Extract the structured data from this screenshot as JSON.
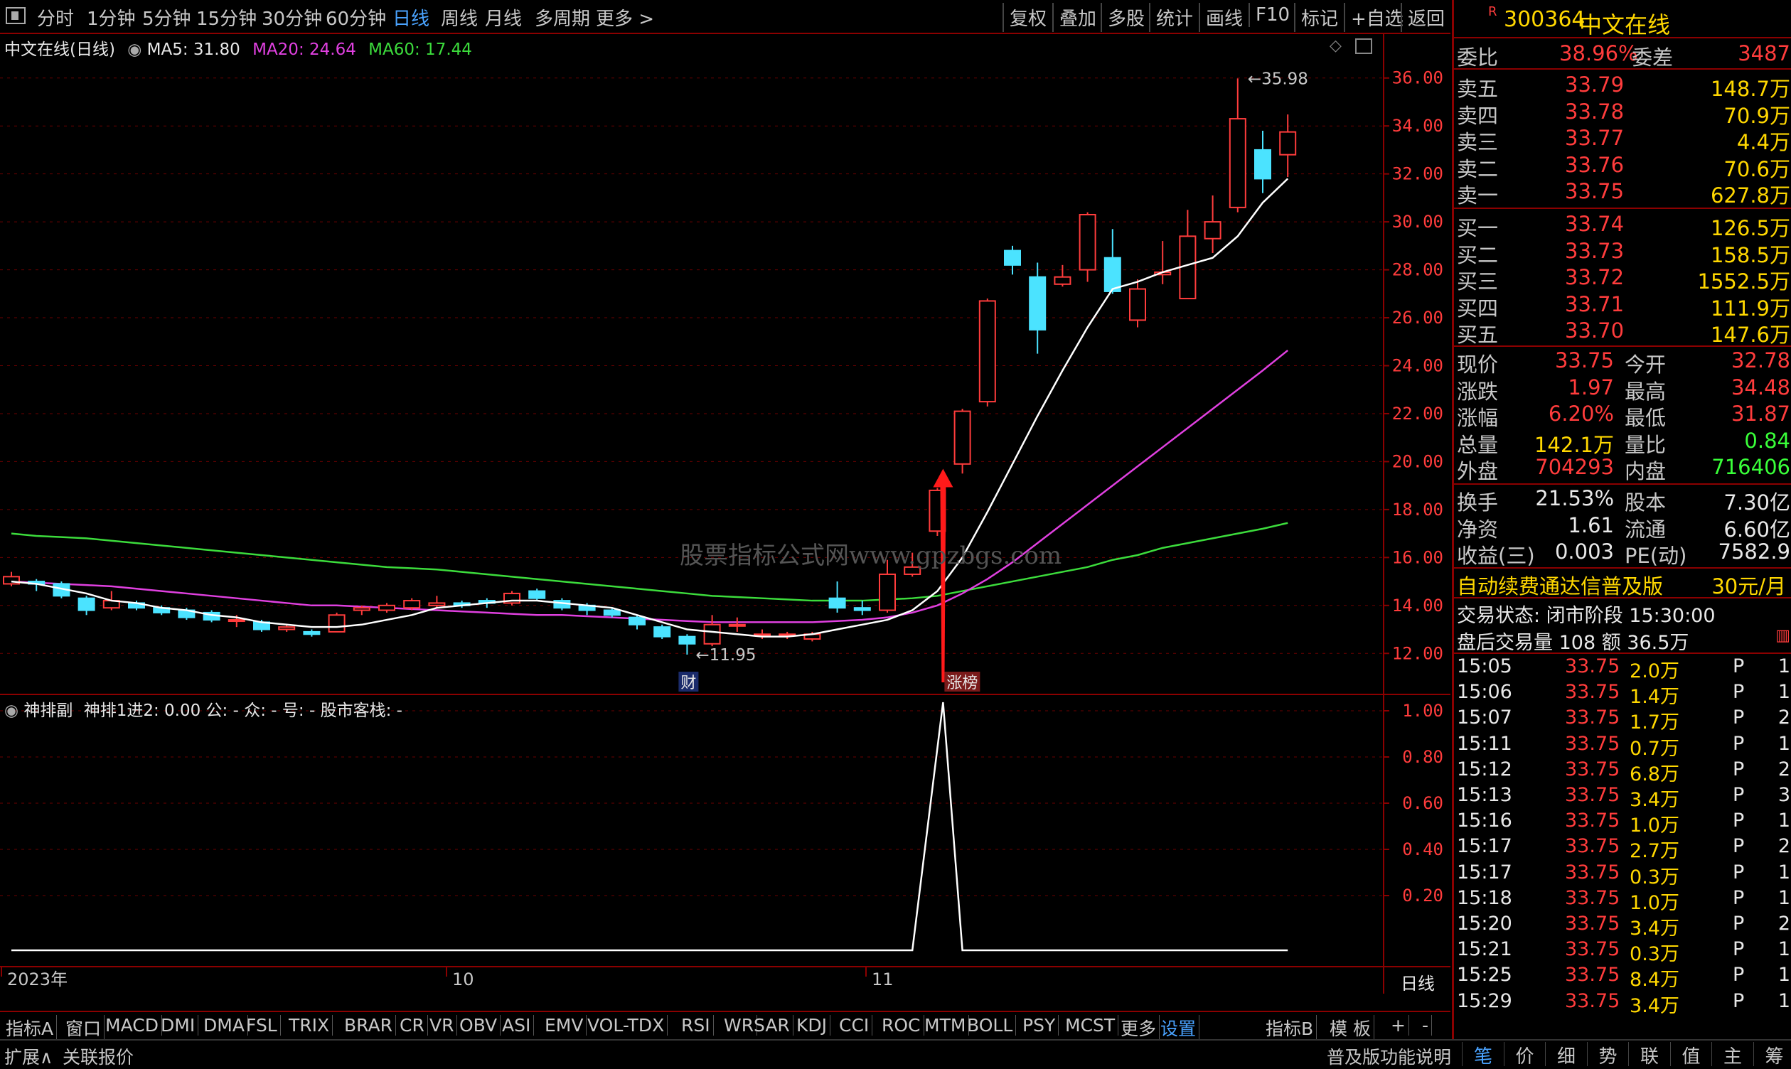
{
  "toolbar": {
    "periods": [
      "分时",
      "1分钟",
      "5分钟",
      "15分钟",
      "30分钟",
      "60分钟",
      "日线",
      "周线",
      "月线",
      "多周期",
      "更多 >"
    ],
    "active_period": "日线",
    "right_buttons": [
      "复权",
      "叠加",
      "多股",
      "统计",
      "画线",
      "F10",
      "标记",
      "+自选",
      "返回"
    ]
  },
  "main_chart": {
    "stock_title": "中文在线(日线)",
    "ma5": "MA5: 31.80",
    "ma20": "MA20: 24.64",
    "ma60": "MA60: 17.44",
    "high_label": "35.98",
    "low_label": "11.95",
    "marker_cai": "财",
    "marker_zhangbang": "涨榜",
    "watermark": "股票指标公式网www.gpzbgs.com",
    "x_labels": [
      "2023年",
      "10",
      "11"
    ],
    "y_ticks": [
      "36.00",
      "34.00",
      "32.00",
      "30.00",
      "28.00",
      "26.00",
      "24.00",
      "22.00",
      "20.00",
      "18.00",
      "16.00",
      "14.00",
      "12.00"
    ]
  },
  "sub_chart": {
    "title": "神排副",
    "params": "神排1进2: 0.00 公: - 众: - 号: - 股市客栈: -",
    "y_ticks": [
      "1.00",
      "0.80",
      "0.60",
      "0.40",
      "0.20"
    ],
    "period_label": "日线"
  },
  "chart_data": {
    "type": "candlestick",
    "ylim": [
      11,
      37
    ],
    "candles": [
      {
        "o": 14.9,
        "c": 15.2,
        "h": 15.4,
        "l": 14.8
      },
      {
        "o": 15.0,
        "c": 14.9,
        "h": 15.1,
        "l": 14.6
      },
      {
        "o": 14.9,
        "c": 14.4,
        "h": 15.0,
        "l": 14.3
      },
      {
        "o": 14.3,
        "c": 13.8,
        "h": 14.4,
        "l": 13.6
      },
      {
        "o": 13.9,
        "c": 14.2,
        "h": 14.6,
        "l": 13.8
      },
      {
        "o": 14.1,
        "c": 13.9,
        "h": 14.2,
        "l": 13.8
      },
      {
        "o": 13.9,
        "c": 13.7,
        "h": 14.0,
        "l": 13.6
      },
      {
        "o": 13.8,
        "c": 13.5,
        "h": 13.9,
        "l": 13.4
      },
      {
        "o": 13.7,
        "c": 13.4,
        "h": 13.8,
        "l": 13.3
      },
      {
        "o": 13.4,
        "c": 13.4,
        "h": 13.6,
        "l": 13.1
      },
      {
        "o": 13.3,
        "c": 13.0,
        "h": 13.4,
        "l": 12.9
      },
      {
        "o": 13.0,
        "c": 13.1,
        "h": 13.2,
        "l": 12.9
      },
      {
        "o": 12.9,
        "c": 12.8,
        "h": 13.0,
        "l": 12.7
      },
      {
        "o": 12.9,
        "c": 13.6,
        "h": 13.7,
        "l": 12.9
      },
      {
        "o": 13.8,
        "c": 13.9,
        "h": 14.0,
        "l": 13.6
      },
      {
        "o": 13.8,
        "c": 14.0,
        "h": 14.1,
        "l": 13.7
      },
      {
        "o": 13.9,
        "c": 14.2,
        "h": 14.3,
        "l": 13.8
      },
      {
        "o": 14.0,
        "c": 14.1,
        "h": 14.4,
        "l": 13.9
      },
      {
        "o": 14.1,
        "c": 14.0,
        "h": 14.2,
        "l": 13.9
      },
      {
        "o": 14.2,
        "c": 14.1,
        "h": 14.3,
        "l": 13.9
      },
      {
        "o": 14.1,
        "c": 14.5,
        "h": 14.6,
        "l": 14.0
      },
      {
        "o": 14.6,
        "c": 14.3,
        "h": 14.7,
        "l": 14.2
      },
      {
        "o": 14.2,
        "c": 13.9,
        "h": 14.3,
        "l": 13.8
      },
      {
        "o": 14.0,
        "c": 13.8,
        "h": 14.1,
        "l": 13.6
      },
      {
        "o": 13.8,
        "c": 13.6,
        "h": 13.9,
        "l": 13.5
      },
      {
        "o": 13.5,
        "c": 13.2,
        "h": 13.6,
        "l": 13.0
      },
      {
        "o": 13.1,
        "c": 12.7,
        "h": 13.2,
        "l": 12.6
      },
      {
        "o": 12.7,
        "c": 12.4,
        "h": 12.8,
        "l": 11.95
      },
      {
        "o": 12.4,
        "c": 13.2,
        "h": 13.6,
        "l": 12.3
      },
      {
        "o": 13.2,
        "c": 13.2,
        "h": 13.5,
        "l": 12.9
      },
      {
        "o": 12.8,
        "c": 12.8,
        "h": 13.0,
        "l": 12.6
      },
      {
        "o": 12.8,
        "c": 12.8,
        "h": 12.9,
        "l": 12.6
      },
      {
        "o": 12.6,
        "c": 12.8,
        "h": 12.9,
        "l": 12.5
      },
      {
        "o": 14.3,
        "c": 13.9,
        "h": 15.0,
        "l": 13.7
      },
      {
        "o": 13.9,
        "c": 13.8,
        "h": 14.2,
        "l": 13.6
      },
      {
        "o": 13.8,
        "c": 15.3,
        "h": 15.9,
        "l": 13.7
      },
      {
        "o": 15.3,
        "c": 15.6,
        "h": 16.2,
        "l": 15.2
      },
      {
        "o": 17.1,
        "c": 18.8,
        "h": 18.9,
        "l": 16.9
      },
      {
        "o": 19.9,
        "c": 22.1,
        "h": 22.2,
        "l": 19.5
      },
      {
        "o": 22.5,
        "c": 26.7,
        "h": 26.8,
        "l": 22.3
      },
      {
        "o": 28.8,
        "c": 28.2,
        "h": 29.0,
        "l": 27.8
      },
      {
        "o": 27.7,
        "c": 25.5,
        "h": 28.3,
        "l": 24.5
      },
      {
        "o": 27.4,
        "c": 27.7,
        "h": 28.2,
        "l": 27.3
      },
      {
        "o": 28.0,
        "c": 30.3,
        "h": 30.4,
        "l": 27.5
      },
      {
        "o": 28.5,
        "c": 27.1,
        "h": 29.7,
        "l": 27.0
      },
      {
        "o": 25.9,
        "c": 27.2,
        "h": 27.6,
        "l": 25.6
      },
      {
        "o": 27.8,
        "c": 27.9,
        "h": 29.2,
        "l": 27.4
      },
      {
        "o": 26.8,
        "c": 29.4,
        "h": 30.5,
        "l": 26.8
      },
      {
        "o": 29.3,
        "c": 30.0,
        "h": 31.1,
        "l": 28.7
      },
      {
        "o": 30.6,
        "c": 34.3,
        "h": 35.98,
        "l": 30.4
      },
      {
        "o": 33.0,
        "c": 31.8,
        "h": 33.8,
        "l": 31.2
      },
      {
        "o": 32.8,
        "c": 33.75,
        "h": 34.48,
        "l": 31.87
      }
    ],
    "ma5": [
      15.0,
      14.9,
      14.7,
      14.5,
      14.2,
      14.1,
      13.9,
      13.8,
      13.6,
      13.5,
      13.3,
      13.2,
      13.1,
      13.1,
      13.2,
      13.4,
      13.6,
      13.9,
      14.0,
      14.1,
      14.2,
      14.2,
      14.1,
      14.0,
      13.9,
      13.6,
      13.3,
      13.0,
      12.9,
      12.8,
      12.7,
      12.7,
      12.8,
      13.0,
      13.2,
      13.4,
      13.8,
      14.6,
      16.0,
      17.9,
      19.9,
      21.9,
      23.8,
      25.6,
      27.2,
      27.5,
      27.9,
      28.2,
      28.5,
      29.4,
      30.8,
      31.8
    ],
    "ma20": [
      15.0,
      14.95,
      14.9,
      14.85,
      14.8,
      14.7,
      14.6,
      14.5,
      14.4,
      14.3,
      14.2,
      14.1,
      14.0,
      14.0,
      13.95,
      13.9,
      13.85,
      13.8,
      13.75,
      13.7,
      13.65,
      13.6,
      13.6,
      13.55,
      13.5,
      13.45,
      13.4,
      13.35,
      13.3,
      13.3,
      13.3,
      13.3,
      13.3,
      13.35,
      13.4,
      13.5,
      13.7,
      14.0,
      14.5,
      15.1,
      15.8,
      16.6,
      17.4,
      18.2,
      19.0,
      19.8,
      20.6,
      21.4,
      22.2,
      23.0,
      23.8,
      24.64
    ],
    "ma60": [
      17.0,
      16.9,
      16.85,
      16.8,
      16.7,
      16.6,
      16.5,
      16.4,
      16.3,
      16.2,
      16.1,
      16.0,
      15.9,
      15.8,
      15.7,
      15.6,
      15.55,
      15.5,
      15.4,
      15.3,
      15.2,
      15.1,
      15.0,
      14.9,
      14.8,
      14.7,
      14.6,
      14.5,
      14.4,
      14.35,
      14.3,
      14.25,
      14.2,
      14.2,
      14.2,
      14.25,
      14.3,
      14.4,
      14.6,
      14.8,
      15.0,
      15.2,
      15.4,
      15.6,
      15.9,
      16.1,
      16.4,
      16.6,
      16.8,
      17.0,
      17.2,
      17.44
    ],
    "signal": [
      0,
      0,
      0,
      0,
      0,
      0,
      0,
      0,
      0,
      0,
      0,
      0,
      0,
      0,
      0,
      0,
      0,
      0,
      0,
      0,
      0,
      0,
      0,
      0,
      0,
      0,
      0,
      0,
      0,
      0,
      0,
      0,
      0,
      0,
      0,
      0,
      0,
      1,
      0,
      0,
      0,
      0,
      0,
      0,
      0,
      0,
      0,
      0,
      0,
      0,
      0,
      0
    ]
  },
  "quote": {
    "tag": "R",
    "code": "300364",
    "name": "中文在线",
    "weibi_label": "委比",
    "weibi_value": "38.96%",
    "weicha_label": "委差",
    "weicha_value": "3487",
    "sells": [
      {
        "label": "卖五",
        "price": "33.79",
        "vol": "148.7万"
      },
      {
        "label": "卖四",
        "price": "33.78",
        "vol": "70.9万"
      },
      {
        "label": "卖三",
        "price": "33.77",
        "vol": "4.4万"
      },
      {
        "label": "卖二",
        "price": "33.76",
        "vol": "70.6万"
      },
      {
        "label": "卖一",
        "price": "33.75",
        "vol": "627.8万"
      }
    ],
    "buys": [
      {
        "label": "买一",
        "price": "33.74",
        "vol": "126.5万"
      },
      {
        "label": "买二",
        "price": "33.73",
        "vol": "158.5万"
      },
      {
        "label": "买三",
        "price": "33.72",
        "vol": "1552.5万"
      },
      {
        "label": "买四",
        "price": "33.71",
        "vol": "111.9万"
      },
      {
        "label": "买五",
        "price": "33.70",
        "vol": "147.6万"
      }
    ],
    "stats": [
      {
        "l1": "现价",
        "v1": "33.75",
        "l2": "今开",
        "v2": "32.78",
        "c1": "red",
        "c2": "red"
      },
      {
        "l1": "涨跌",
        "v1": "1.97",
        "l2": "最高",
        "v2": "34.48",
        "c1": "red",
        "c2": "red"
      },
      {
        "l1": "涨幅",
        "v1": "6.20%",
        "l2": "最低",
        "v2": "31.87",
        "c1": "red",
        "c2": "red"
      },
      {
        "l1": "总量",
        "v1": "142.1万",
        "l2": "量比",
        "v2": "0.84",
        "c1": "yellow",
        "c2": "green"
      },
      {
        "l1": "外盘",
        "v1": "704293",
        "l2": "内盘",
        "v2": "716406",
        "c1": "red",
        "c2": "green"
      }
    ],
    "fin": [
      {
        "l1": "换手",
        "v1": "21.53%",
        "l2": "股本",
        "v2": "7.30亿"
      },
      {
        "l1": "净资",
        "v1": "1.61",
        "l2": "流通",
        "v2": "6.60亿"
      },
      {
        "l1": "收益(三)",
        "v1": "0.003",
        "l2": "PE(动)",
        "v2": "7582.9"
      }
    ],
    "promo": "自动续费通达信普及版",
    "promo_price": "30元/月",
    "trade_status": "交易状态: 闭市阶段 15:30:00",
    "after_hours": "盘后交易量 108 额 36.5万"
  },
  "ticks": [
    {
      "t": "15:05",
      "p": "33.75",
      "v": "2.0万",
      "f": "P",
      "n": "1"
    },
    {
      "t": "15:06",
      "p": "33.75",
      "v": "1.4万",
      "f": "P",
      "n": "1"
    },
    {
      "t": "15:07",
      "p": "33.75",
      "v": "1.7万",
      "f": "P",
      "n": "2"
    },
    {
      "t": "15:11",
      "p": "33.75",
      "v": "0.7万",
      "f": "P",
      "n": "1"
    },
    {
      "t": "15:12",
      "p": "33.75",
      "v": "6.8万",
      "f": "P",
      "n": "2"
    },
    {
      "t": "15:13",
      "p": "33.75",
      "v": "3.4万",
      "f": "P",
      "n": "3"
    },
    {
      "t": "15:16",
      "p": "33.75",
      "v": "1.0万",
      "f": "P",
      "n": "1"
    },
    {
      "t": "15:17",
      "p": "33.75",
      "v": "2.7万",
      "f": "P",
      "n": "2"
    },
    {
      "t": "15:17",
      "p": "33.75",
      "v": "0.3万",
      "f": "P",
      "n": "1"
    },
    {
      "t": "15:18",
      "p": "33.75",
      "v": "1.0万",
      "f": "P",
      "n": "1"
    },
    {
      "t": "15:20",
      "p": "33.75",
      "v": "3.4万",
      "f": "P",
      "n": "2"
    },
    {
      "t": "15:21",
      "p": "33.75",
      "v": "0.3万",
      "f": "P",
      "n": "1"
    },
    {
      "t": "15:25",
      "p": "33.75",
      "v": "8.4万",
      "f": "P",
      "n": "1"
    },
    {
      "t": "15:29",
      "p": "33.75",
      "v": "3.4万",
      "f": "P",
      "n": "1"
    }
  ],
  "bottom_tabs": [
    "指标A",
    "窗口",
    "MACD",
    "DMI",
    "DMA",
    "FSL",
    "TRIX",
    "BRAR",
    "CR",
    "VR",
    "OBV",
    "ASI",
    "EMV",
    "VOL-TDX",
    "RSI",
    "WR",
    "SAR",
    "KDJ",
    "CCI",
    "ROC",
    "MTM",
    "BOLL",
    "PSY",
    "MCST",
    "更多",
    "设置"
  ],
  "active_tab": "设置",
  "bottom_right_tabs": [
    "指标B",
    "模 板",
    "+",
    "-"
  ],
  "status": {
    "expand": "扩展∧",
    "related": "关联报价",
    "help": "普及版功能说明",
    "buttons": [
      "笔",
      "价",
      "细",
      "势",
      "联",
      "值",
      "主",
      "筹"
    ],
    "active_button": "笔"
  },
  "colors": {
    "up": "#ff3c3c",
    "down": "#4be3ff",
    "ma5": "#ffffff",
    "ma20": "#e040e0",
    "ma60": "#3cdc3c",
    "grid": "#8b0000",
    "accent": "#4aa3ff"
  }
}
